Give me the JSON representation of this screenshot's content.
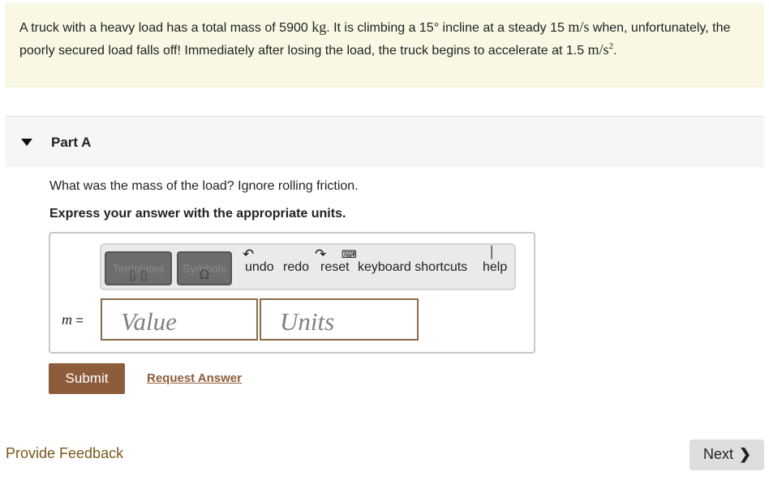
{
  "problem": {
    "text_1": "A truck with a heavy load has a total mass of 5900 ",
    "mass_unit": "kg",
    "text_2": ". It is climbing a 15° incline at a steady 15 ",
    "speed_unit": "m/s",
    "text_3": " when, unfortunately, the poorly secured load falls off! Immediately after losing the load, the truck begins to accelerate at 1.5 ",
    "accel_unit_base": "m/s",
    "accel_unit_exp": "2",
    "text_4": "."
  },
  "part": {
    "title": "Part A"
  },
  "question": {
    "prompt": "What was the mass of the load? Ignore rolling friction.",
    "instruction": "Express your answer with the appropriate units."
  },
  "toolbar": {
    "templates_label": "Templates",
    "symbols_label": "Symbols",
    "undo_label": "undo",
    "redo_label": "redo",
    "reset_label": "reset",
    "keyboard_label": "keyboard shortcuts",
    "help_label": "help"
  },
  "answer": {
    "variable": "m",
    "equals": "=",
    "value_placeholder": "Value",
    "units_placeholder": "Units"
  },
  "actions": {
    "submit_label": "Submit",
    "request_label": "Request Answer"
  },
  "footer": {
    "feedback_label": "Provide Feedback",
    "next_label": "Next"
  },
  "colors": {
    "problem_bg": "#f8f8e4",
    "submit_bg": "#8d5d3b",
    "field_border": "#8c6a4a"
  },
  "icons": [
    "caret-down-icon",
    "undo-arrow-icon",
    "redo-arrow-icon",
    "reset-icon",
    "keyboard-icon",
    "help-icon",
    "chevron-right-icon"
  ]
}
